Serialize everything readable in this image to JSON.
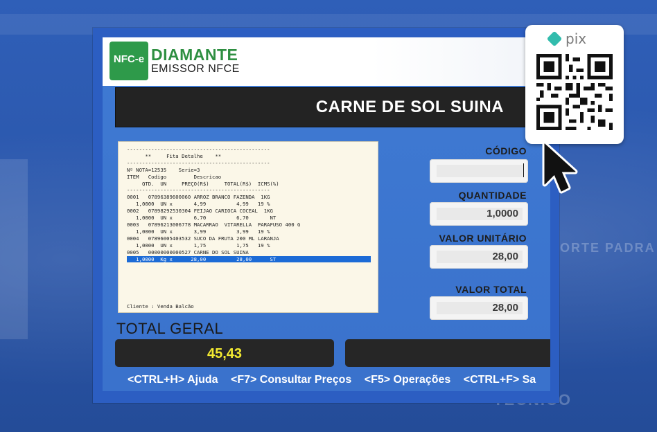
{
  "background": {
    "blurred_text_1": "ORTE PADRA",
    "blurred_text_2": "TECNICO"
  },
  "app": {
    "brand_title": "DIAMANTE",
    "brand_subtitle": "EMISSOR NFCE",
    "logo_label": "NFC-e"
  },
  "product": {
    "name": "CARNE DE  SOL SUINA"
  },
  "receipt": {
    "lines": [
      "-----------------------------------------------",
      "      **     Fita Detalhe    **",
      "-----------------------------------------------",
      "Nº NOTA=12535    Serie=3",
      "ITEM   Codigo         Descricao",
      "     QTD.  UN     PREÇO(R$)     TOTAL(R$)  ICMS(%)",
      "-----------------------------------------------",
      "0001   07896389600060 ARROZ BRANCO FAZENDA  1KG",
      "   1,0000  UN x       4,99          4,99   19 %",
      "0002   07898292530304 FEIJAO CARIOCA COCEAL  1KG",
      "   1,0000  UN x       6,70          6,70       NT",
      "0003   07896213006778 MACARRAO  VITARELLA  PARAFUSO 400 G",
      "   1,0000  UN x       3,99          3,99   19 %",
      "0004   07896005403532 SUCO DA FRUTA 200 ML LARANJA",
      "   1,0000  UN x       1,75          1,75   19 %",
      "0005   00000000000527 CARNE DO SOL SUINA"
    ],
    "highlight_line": "   1,0000  Kg x      28,00          28,00      ST",
    "client": "Cliente : Venda Balcão"
  },
  "fields": {
    "codigo_label": "CÓDIGO",
    "codigo_value": "",
    "quantidade_label": "QUANTIDADE",
    "quantidade_value": "1,0000",
    "valor_unitario_label": "VALOR UNITÁRIO",
    "valor_unitario_value": "28,00",
    "valor_total_label": "VALOR TOTAL",
    "valor_total_value": "28,00"
  },
  "total": {
    "label": "TOTAL GERAL",
    "value": "45,43"
  },
  "shortcuts": [
    "<CTRL+H> Ajuda",
    "<F7> Consultar Preços",
    "<F5> Operações",
    "<CTRL+F> Sa"
  ],
  "pix": {
    "label": "pix"
  },
  "colors": {
    "brand_green": "#2e8f41",
    "total_yellow": "#f3ea31",
    "pix_teal": "#32bcad",
    "highlight_blue": "#1c6bd6"
  }
}
